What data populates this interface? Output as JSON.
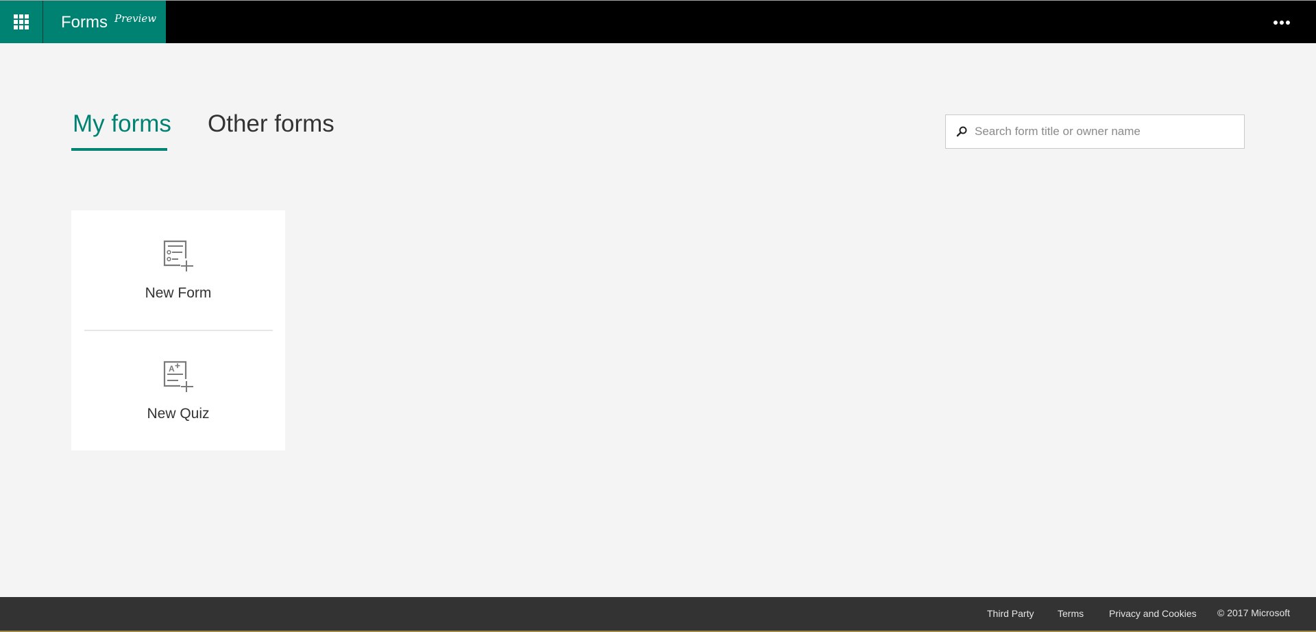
{
  "header": {
    "app_name": "Forms",
    "preview_tag": "Preview",
    "waffle_icon": "app-launcher-icon",
    "more_icon": "more-options-icon"
  },
  "tabs": [
    {
      "label": "My forms",
      "selected": true
    },
    {
      "label": "Other forms",
      "selected": false
    }
  ],
  "search": {
    "placeholder": "Search form title or owner name",
    "value": "",
    "icon": "search-icon"
  },
  "create_card": {
    "new_form": {
      "label": "New Form",
      "icon": "new-form-icon"
    },
    "new_quiz": {
      "label": "New Quiz",
      "icon": "new-quiz-icon"
    }
  },
  "footer": {
    "links": [
      "Third Party",
      "Terms",
      "Privacy and Cookies"
    ],
    "copyright": "© 2017 Microsoft"
  },
  "colors": {
    "brand": "#008272",
    "header_bg": "#000000",
    "footer_bg": "#333333",
    "page_bg": "#f4f4f4"
  }
}
